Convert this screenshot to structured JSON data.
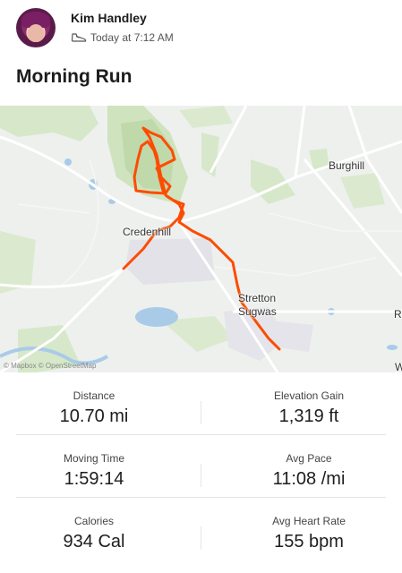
{
  "activity": {
    "athlete_name": "Kim Handley",
    "timestamp": "Today at 7:12 AM",
    "title": "Morning Run",
    "activity_icon": "shoe-icon"
  },
  "map": {
    "labels": {
      "burghill": "Burghill",
      "credenhill": "Credenhill",
      "stretton_sugwas_line1": "Stretton",
      "stretton_sugwas_line2": "Sugwas",
      "edge_r": "R",
      "edge_w": "W"
    },
    "attribution": "© Mapbox © OpenStreetMap",
    "route_color": "#fc4c02"
  },
  "stats": [
    {
      "label": "Distance",
      "value": "10.70 mi"
    },
    {
      "label": "Elevation Gain",
      "value": "1,319 ft"
    },
    {
      "label": "Moving Time",
      "value": "1:59:14"
    },
    {
      "label": "Avg Pace",
      "value": "11:08 /mi"
    },
    {
      "label": "Calories",
      "value": "934 Cal"
    },
    {
      "label": "Avg Heart Rate",
      "value": "155 bpm"
    }
  ]
}
